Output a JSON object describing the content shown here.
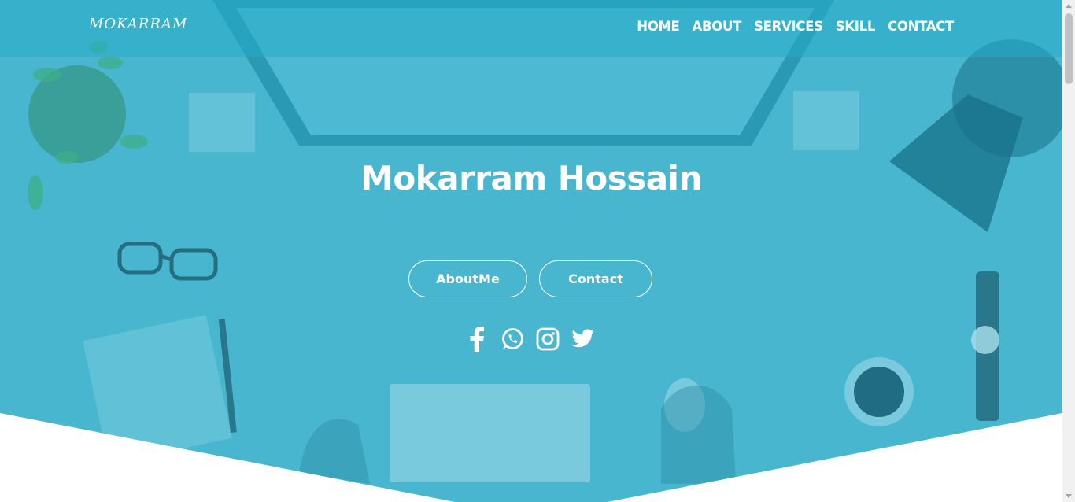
{
  "brand": "MOKARRAM",
  "nav": {
    "home": "HOME",
    "about": "ABOUT",
    "services": "SERVICES",
    "skill": "SKILL",
    "contact": "CONTACT"
  },
  "hero": {
    "name": "Mokarram Hossain",
    "about_button": "AboutMe",
    "contact_button": "Contact"
  },
  "socials": [
    "facebook-icon",
    "whatsapp-icon",
    "instagram-icon",
    "twitter-icon"
  ],
  "colors": {
    "hero_overlay": "#49b6cf",
    "text": "#ffffff"
  }
}
